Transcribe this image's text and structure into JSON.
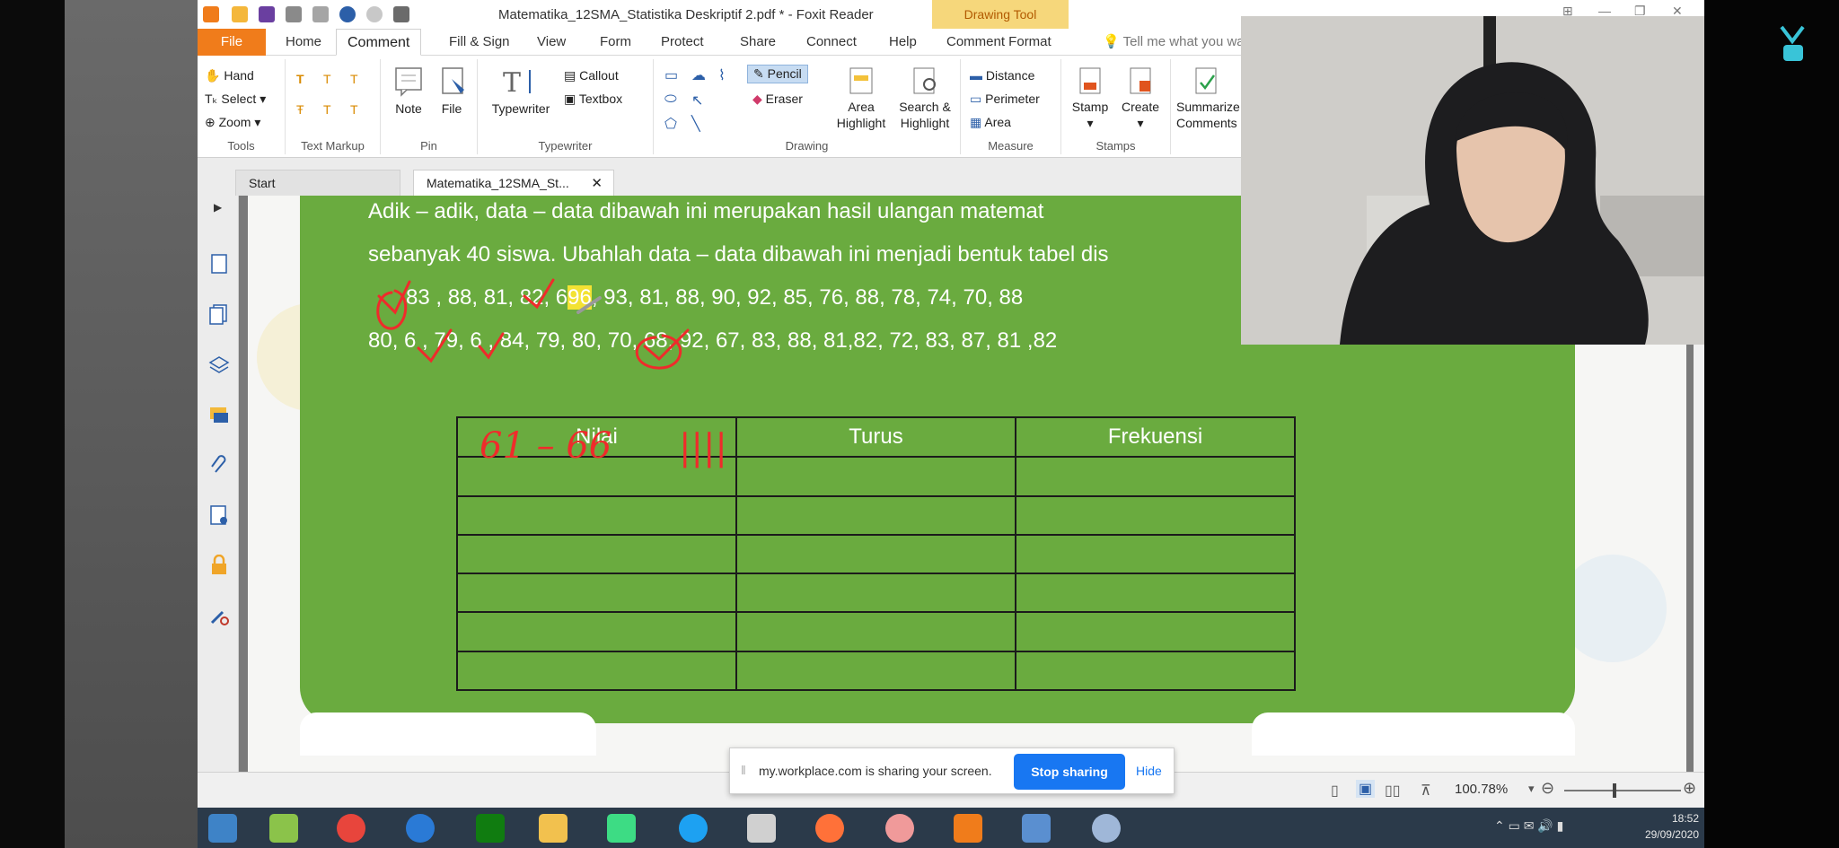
{
  "window": {
    "title": "Matematika_12SMA_Statistika Deskriptif 2.pdf * - Foxit Reader",
    "context_tab": "Drawing Tool",
    "controls": [
      "⊞",
      "—",
      "❐",
      "✕"
    ]
  },
  "menu": {
    "items": [
      "File",
      "Home",
      "Comment",
      "Fill & Sign",
      "View",
      "Form",
      "Protect",
      "Share",
      "Connect",
      "Help",
      "Comment Format"
    ],
    "active": "Comment",
    "tell_me": "Tell me what you wa"
  },
  "ribbon": {
    "tools": {
      "hand": "Hand",
      "select": "Select",
      "zoom": "Zoom",
      "group": "Tools"
    },
    "text_markup": {
      "group": "Text Markup"
    },
    "pin": {
      "note": "Note",
      "file": "File",
      "group": "Pin"
    },
    "typewriter": {
      "typewriter": "Typewriter",
      "callout": "Callout",
      "textbox": "Textbox",
      "group": "Typewriter"
    },
    "drawing": {
      "pencil": "Pencil",
      "eraser": "Eraser",
      "area_highlight": "Area Highlight",
      "search_highlight": "Search & Highlight",
      "group": "Drawing"
    },
    "measure": {
      "distance": "Distance",
      "perimeter": "Perimeter",
      "area": "Area",
      "group": "Measure"
    },
    "stamps": {
      "stamp": "Stamp",
      "create": "Create",
      "group": "Stamps"
    },
    "summarize": "Summarize Comments"
  },
  "tabs": {
    "start": "Start",
    "doc": "Matematika_12SMA_St..."
  },
  "document": {
    "line1": "Adik – adik, data – data dibawah ini merupakan hasil  ulangan matemat",
    "line2": "sebanyak 40 siswa. Ubahlah data – data dibawah ini menjadi bentuk tabel dis",
    "line3_a": "83 , 88, 81, 82, 6",
    "line3_hl": "96",
    "line3_b": ", 93, 81, 88, 90, 92, 85, 76, 88, 78, 74, 70, 88",
    "line4": "80, 6  , 79, 6  , 84, 79, 80, 70, 68, 92, 67, 83, 88, 81,82, 72, 83, 87, 81 ,82",
    "table_headers": [
      "Nilai",
      "Turus",
      "Frekuensi"
    ],
    "ink_interval": "61 – 66",
    "ink_tally": "||||"
  },
  "status": {
    "zoom": "100.78%"
  },
  "share_bar": {
    "message": "my.workplace.com is sharing your screen.",
    "stop": "Stop sharing",
    "hide": "Hide"
  },
  "taskbar": {
    "time": "18:52",
    "date": "29/09/2020"
  },
  "colors": {
    "file_orange": "#f07c1b",
    "page_green": "#6aab3f",
    "ink_red": "#ef2b2b",
    "share_blue": "#1877f2"
  }
}
